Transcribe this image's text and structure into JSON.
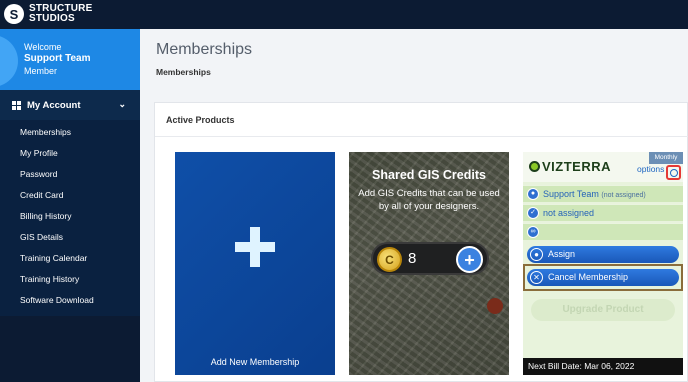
{
  "brand": {
    "logo_letter": "S",
    "line1": "STRUCTURE",
    "line2": "STUDIOS"
  },
  "user": {
    "welcome": "Welcome",
    "name": "Support Team",
    "role": "Member"
  },
  "nav": {
    "heading": "My Account",
    "items": [
      "Memberships",
      "My Profile",
      "Password",
      "Credit Card",
      "Billing History",
      "GIS Details",
      "Training Calendar",
      "Training History",
      "Software Download"
    ]
  },
  "page": {
    "title": "Memberships",
    "breadcrumb": "Memberships"
  },
  "panel": {
    "title": "Active Products"
  },
  "add_card": {
    "label": "Add New Membership"
  },
  "gis_card": {
    "title": "Shared GIS Credits",
    "description": "Add GIS Credits that can be used by all of your designers.",
    "coin_symbol": "C",
    "count": "8",
    "plus": "+"
  },
  "viz_card": {
    "logo": "VIZTERRA",
    "badge": "Monthly",
    "options_label": "options",
    "owner": "Support Team",
    "owner_note": "(not assigned)",
    "status": "not assigned",
    "assign_label": "Assign",
    "cancel_label": "Cancel Membership",
    "upgrade_label": "Upgrade Product",
    "footer": "Next Bill Date: Mar 06, 2022"
  },
  "colors": {
    "sidebar": "#0c1b33",
    "welcome_bg": "#1e88e5",
    "add_card": "#0f4fa8",
    "highlight_red": "#e53935",
    "highlight_brown": "#8a6d3b"
  },
  "icons": [
    "grid-icon",
    "chevron-down-icon",
    "plus-icon",
    "coin-icon",
    "settings-icon",
    "user-icon",
    "user-check-icon",
    "link-icon",
    "close-circle-icon"
  ]
}
